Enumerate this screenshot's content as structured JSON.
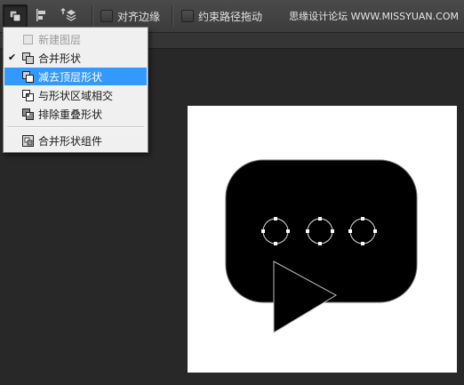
{
  "options_bar": {
    "align_edges_label": "对齐边缘",
    "constrain_path_label": "约束路径拖动",
    "watermark": "思缘设计论坛 WWW.MISSYUAN.COM"
  },
  "path_ops_menu": {
    "items": [
      {
        "label": "新建图层",
        "state": "disabled"
      },
      {
        "label": "合并形状",
        "state": "checked"
      },
      {
        "label": "减去顶层形状",
        "state": "selected"
      },
      {
        "label": "与形状区域相交",
        "state": "normal"
      },
      {
        "label": "排除重叠形状",
        "state": "normal"
      },
      {
        "label": "合并形状组件",
        "state": "normal"
      }
    ],
    "check_mark": "✔"
  },
  "icons": {
    "path_operations": "path-operations-icon",
    "path_alignment": "path-alignment-icon",
    "path_arrangement": "path-arrangement-icon"
  },
  "colors": {
    "options_bar": "#3c3c3c",
    "workspace": "#282828",
    "menu_highlight": "#3399ff",
    "shape_fill": "#000000"
  }
}
